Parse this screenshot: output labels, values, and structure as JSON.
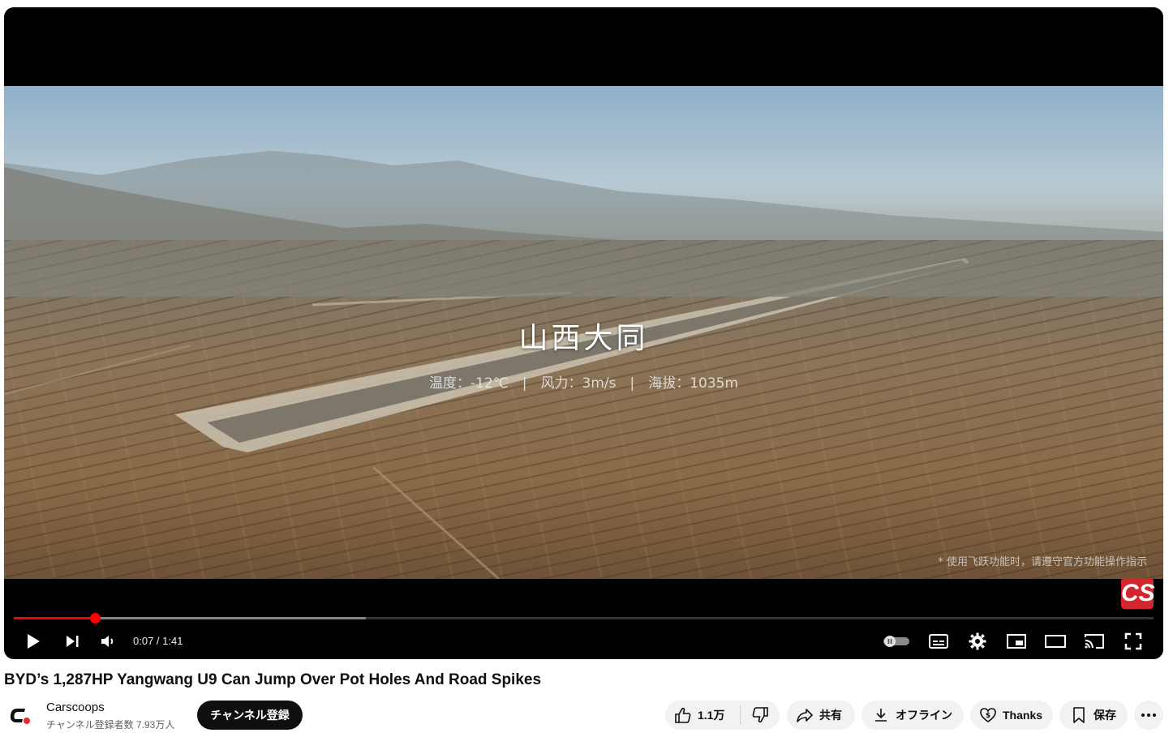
{
  "video": {
    "overlay_title": "山西大同",
    "overlay_info": "温度：-12℃　|　风力：3m/s　|　海拔：1035m",
    "overlay_note": "* 使用飞跃功能时，请遵守官方功能操作指示",
    "channel_watermark": "CS"
  },
  "player": {
    "current_time": "0:07",
    "duration": "1:41",
    "time_display": "0:07 / 1:41",
    "played_fraction": 0.0713,
    "buffered_fraction": 0.309
  },
  "video_title": "BYD’s 1,287HP Yangwang U9 Can Jump Over Pot Holes And Road Spikes",
  "channel": {
    "name": "Carscoops",
    "subscribers": "チャンネル登録者数 7.93万人",
    "subscribe_label": "チャンネル登録"
  },
  "actions": {
    "like_count": "1.1万",
    "share_label": "共有",
    "offline_label": "オフライン",
    "thanks_label": "Thanks",
    "save_label": "保存"
  },
  "colors": {
    "progress_played": "#ff0000",
    "brand_red": "#d3262d",
    "subscribe_bg": "#0f0f0f",
    "pill_bg": "#f2f2f2"
  }
}
